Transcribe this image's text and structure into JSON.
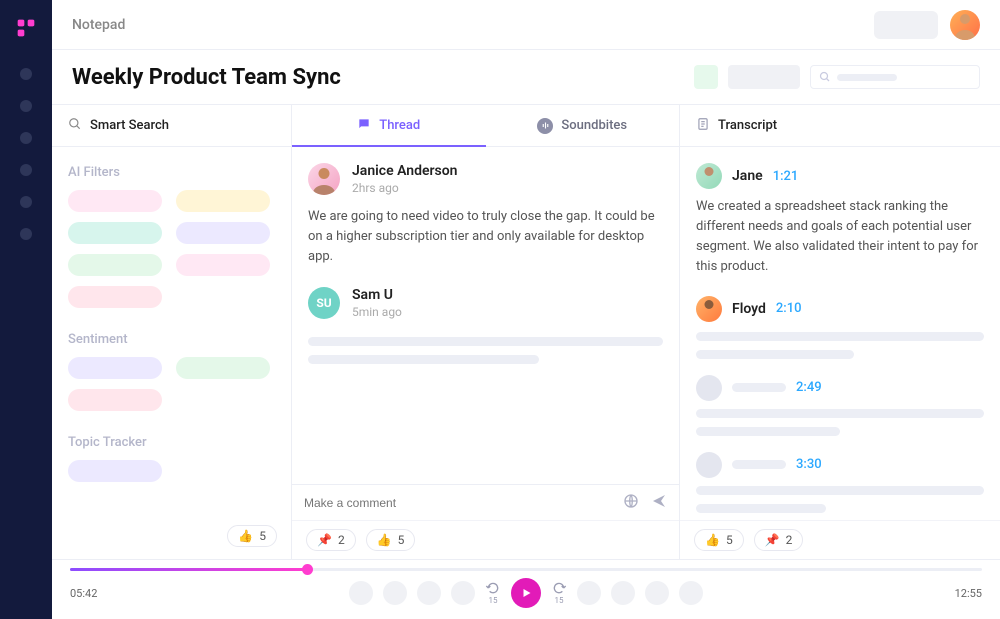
{
  "app": {
    "title": "Notepad"
  },
  "page": {
    "title": "Weekly Product Team Sync"
  },
  "smart_search": {
    "label": "Smart Search",
    "sections": {
      "ai_filters": "AI Filters",
      "sentiment": "Sentiment",
      "topic_tracker": "Topic Tracker"
    },
    "reaction": {
      "count": "5"
    }
  },
  "thread": {
    "tabs": {
      "thread": "Thread",
      "soundbites": "Soundbites"
    },
    "messages": [
      {
        "name": "Janice Anderson",
        "time": "2hrs ago",
        "body": "We are going to need video to truly close the gap. It could be on a higher subscription tier and only available for desktop app."
      },
      {
        "name": "Sam U",
        "initials": "SU",
        "time": "5min ago"
      }
    ],
    "comment_placeholder": "Make a comment",
    "reactions": {
      "pin": "2",
      "like": "5"
    }
  },
  "transcript": {
    "label": "Transcript",
    "entries": [
      {
        "name": "Jane",
        "ts": "1:21",
        "text": "We created a spreadsheet stack ranking the different needs and goals of each potential user segment. We also validated their intent to pay for this product."
      },
      {
        "name": "Floyd",
        "ts": "2:10"
      },
      {
        "ts": "2:49"
      },
      {
        "ts": "3:30"
      }
    ],
    "reactions": {
      "like": "5",
      "pin": "2"
    }
  },
  "player": {
    "current": "05:42",
    "total": "12:55",
    "rewind": "15",
    "forward": "15",
    "progress_pct": 26
  }
}
